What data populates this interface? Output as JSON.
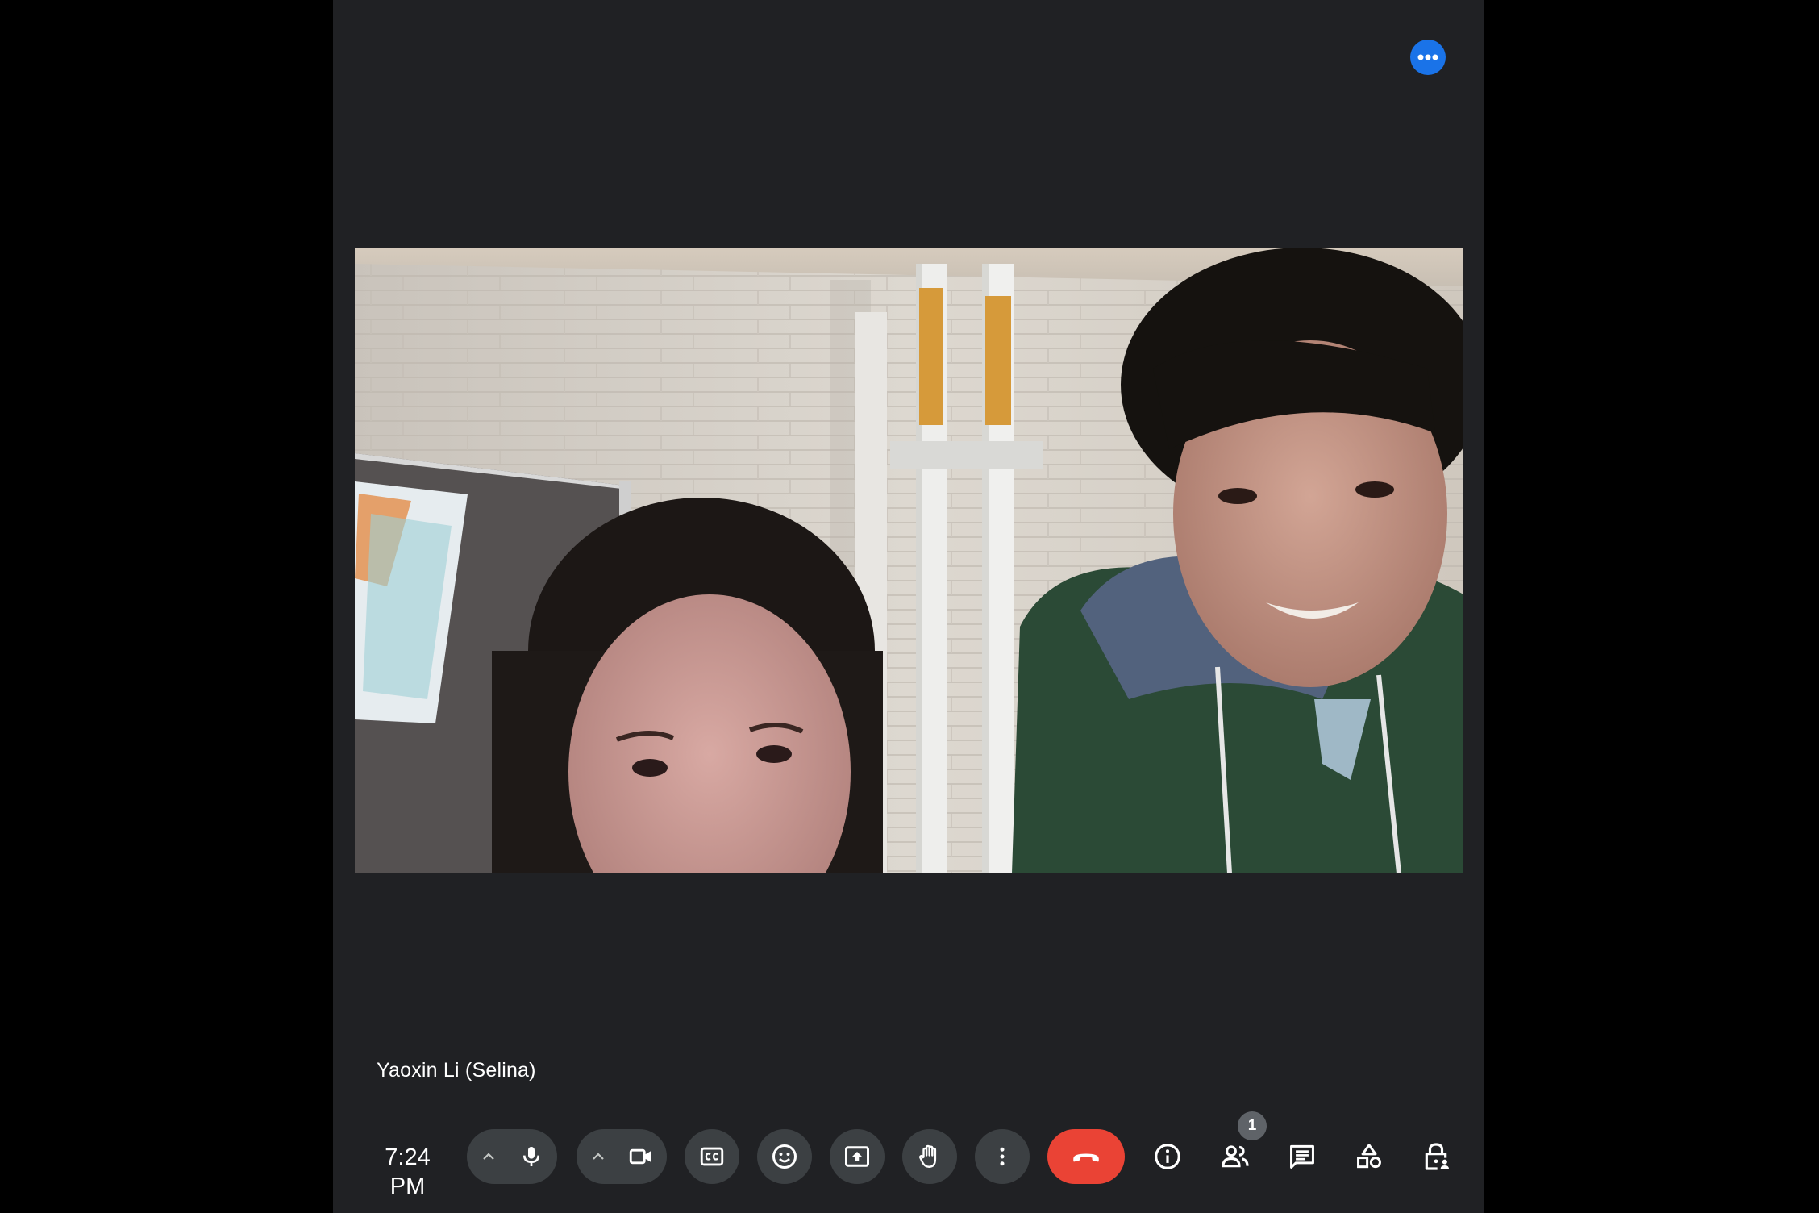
{
  "participant": {
    "name": "Yaoxin Li (Selina)"
  },
  "status": {
    "time": "7:24 PM",
    "people_count": "1"
  },
  "colors": {
    "window_bg": "#202124",
    "control_bg": "#3c4043",
    "leave_red": "#ea4335",
    "accent_blue": "#1a73e8"
  },
  "controls": [
    {
      "name": "audio-settings-toggle",
      "icon": "chevron-up-icon"
    },
    {
      "name": "microphone",
      "icon": "microphone-icon"
    },
    {
      "name": "video-settings-toggle",
      "icon": "chevron-up-icon"
    },
    {
      "name": "camera",
      "icon": "video-camera-icon"
    },
    {
      "name": "captions",
      "icon": "closed-captions-icon"
    },
    {
      "name": "reactions",
      "icon": "smiley-icon"
    },
    {
      "name": "present",
      "icon": "present-screen-icon"
    },
    {
      "name": "raise-hand",
      "icon": "hand-icon"
    },
    {
      "name": "more-options",
      "icon": "vertical-dots-icon"
    },
    {
      "name": "leave-call",
      "icon": "hang-up-icon"
    },
    {
      "name": "meeting-details",
      "icon": "info-icon"
    },
    {
      "name": "people",
      "icon": "people-icon"
    },
    {
      "name": "chat",
      "icon": "chat-icon"
    },
    {
      "name": "activities",
      "icon": "shapes-icon"
    },
    {
      "name": "host-controls",
      "icon": "lock-person-icon"
    }
  ]
}
